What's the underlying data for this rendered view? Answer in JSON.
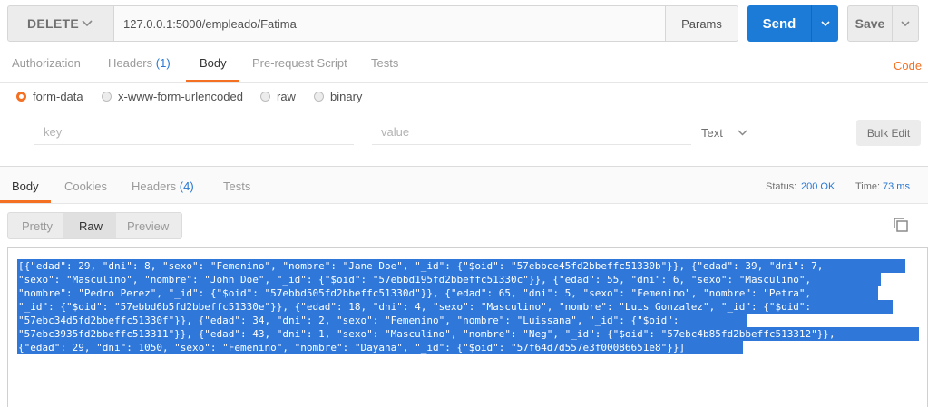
{
  "request": {
    "method": "DELETE",
    "url": "127.0.0.1:5000/empleado/Fatima",
    "params_label": "Params",
    "send_label": "Send",
    "save_label": "Save"
  },
  "request_tabs": {
    "authorization": "Authorization",
    "headers": "Headers",
    "headers_count": "(1)",
    "body": "Body",
    "prerequest": "Pre-request Script",
    "tests": "Tests",
    "code": "Code"
  },
  "body_modes": {
    "form_data": "form-data",
    "urlencoded": "x-www-form-urlencoded",
    "raw": "raw",
    "binary": "binary",
    "selected": "form-data"
  },
  "kv_row": {
    "key_placeholder": "key",
    "value_placeholder": "value",
    "type": "Text",
    "bulk_edit": "Bulk Edit"
  },
  "response_tabs": {
    "body": "Body",
    "cookies": "Cookies",
    "headers": "Headers",
    "headers_count": "(4)",
    "tests": "Tests"
  },
  "response_status": {
    "status_label": "Status:",
    "status_value": "200 OK",
    "time_label": "Time:",
    "time_value": "73 ms"
  },
  "format_tabs": {
    "pretty": "Pretty",
    "raw": "Raw",
    "preview": "Preview",
    "selected": "Raw"
  },
  "response_body": [
    "[{\"edad\": 29, \"dni\": 8, \"sexo\": \"Femenino\", \"nombre\": \"Jane Doe\", \"_id\": {\"$oid\": \"57ebbce45fd2bbeffc51330b\"}}, {\"edad\": 39, \"dni\": 7,",
    "\"sexo\": \"Masculino\", \"nombre\": \"John Doe\", \"_id\": {\"$oid\": \"57ebbd195fd2bbeffc51330c\"}}, {\"edad\": 55, \"dni\": 6, \"sexo\": \"Masculino\",",
    "\"nombre\": \"Pedro Perez\", \"_id\": {\"$oid\": \"57ebbd505fd2bbeffc51330d\"}}, {\"edad\": 65, \"dni\": 5, \"sexo\": \"Femenino\", \"nombre\": \"Petra\",",
    "\"_id\": {\"$oid\": \"57ebbd6b5fd2bbeffc51330e\"}}, {\"edad\": 18, \"dni\": 4, \"sexo\": \"Masculino\", \"nombre\": \"Luis Gonzalez\", \"_id\": {\"$oid\":",
    "\"57ebc34d5fd2bbeffc51330f\"}}, {\"edad\": 34, \"dni\": 2, \"sexo\": \"Femenino\", \"nombre\": \"Luissana\", \"_id\": {\"$oid\":",
    "\"57ebc3935fd2bbeffc513311\"}}, {\"edad\": 43, \"dni\": 1, \"sexo\": \"Masculino\", \"nombre\": \"Neg\", \"_id\": {\"$oid\": \"57ebc4b85fd2bbeffc513312\"}},",
    "{\"edad\": 29, \"dni\": 1050, \"sexo\": \"Femenino\", \"nombre\": \"Dayana\", \"_id\": {\"$oid\": \"57f64d7d557e3f00086651e8\"}}]"
  ],
  "colors": {
    "accent": "#f47023",
    "primary": "#1b7bd6",
    "selection": "#2f77d9",
    "count": "#2a78d2"
  }
}
